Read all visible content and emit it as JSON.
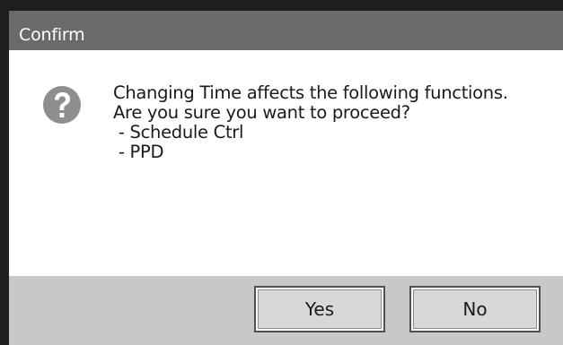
{
  "dialog": {
    "title": "Confirm",
    "icon": "question-icon",
    "message_lines": [
      "Changing Time affects the following functions.",
      "Are you sure you want to proceed?",
      " - Schedule Ctrl",
      " - PPD"
    ],
    "buttons": {
      "yes_label": "Yes",
      "no_label": "No"
    }
  },
  "colors": {
    "title_bar": "#6a6a6a",
    "footer": "#c8c8c8",
    "icon": "#8e8e8e"
  }
}
